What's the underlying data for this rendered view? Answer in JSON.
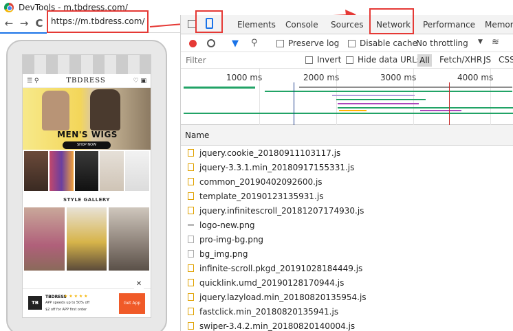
{
  "window": {
    "title": "DevTools - m.tbdress.com/"
  },
  "browser": {
    "url": "https://m.tbdress.com/",
    "back_glyph": "←",
    "forward_glyph": "→",
    "reload_glyph": "C"
  },
  "mobile": {
    "logo": "TBDRESS",
    "banner_title": "MEN'S WIGS",
    "banner_button": "SHOP NOW",
    "gallery_title": "STYLE GALLERY",
    "thumb_colors": [
      "#6b4a3a",
      "#c2486b",
      "#3a3a3a",
      "#e6e0d8",
      "#f2f2f2"
    ],
    "gallery_colors": [
      "#c9a89a",
      "#d7b44a",
      "#8a7f76"
    ],
    "app_banner": {
      "logo": "TB",
      "brand": "TBDRESS",
      "stars": "★ ★ ★ ★ ★",
      "line1": "APP speeds up to 50% off",
      "line2": "$2 off for APP first order",
      "button": "Get App",
      "close": "✕"
    }
  },
  "devtools": {
    "tabs": [
      "Elements",
      "Console",
      "Sources",
      "Network",
      "Performance",
      "Memory"
    ],
    "toolbar": {
      "preserve_log": "Preserve log",
      "disable_cache": "Disable cache",
      "throttling": "No throttling"
    },
    "filter": {
      "placeholder": "Filter",
      "invert": "Invert",
      "hide_data_urls": "Hide data URLs",
      "types": [
        "All",
        "Fetch/XHR",
        "JS",
        "CSS"
      ]
    },
    "timeline": {
      "ticks": [
        "1000 ms",
        "2000 ms",
        "3000 ms",
        "4000 ms"
      ]
    },
    "table": {
      "column_name": "Name",
      "requests": [
        {
          "name": "jquery.cookie_20180911103117.js",
          "type": "js"
        },
        {
          "name": "jquery-3.3.1.min_20180917155331.js",
          "type": "js"
        },
        {
          "name": "common_20190402092600.js",
          "type": "js"
        },
        {
          "name": "template_20190123135931.js",
          "type": "js"
        },
        {
          "name": "jquery.infinitescroll_20181207174930.js",
          "type": "js"
        },
        {
          "name": "logo-new.png",
          "type": "bar"
        },
        {
          "name": "pro-img-bg.png",
          "type": "img"
        },
        {
          "name": "bg_img.png",
          "type": "img"
        },
        {
          "name": "infinite-scroll.pkgd_20191028184449.js",
          "type": "js"
        },
        {
          "name": "quicklink.umd_20190128170944.js",
          "type": "js"
        },
        {
          "name": "jquery.lazyload.min_20180820135954.js",
          "type": "js"
        },
        {
          "name": "fastclick.min_20180820135941.js",
          "type": "js"
        },
        {
          "name": "swiper-3.4.2.min_20180820140004.js",
          "type": "js"
        }
      ]
    },
    "colors": {
      "accent": "#1a73e8",
      "record": "#e53935",
      "highlight": "#e53935"
    }
  }
}
